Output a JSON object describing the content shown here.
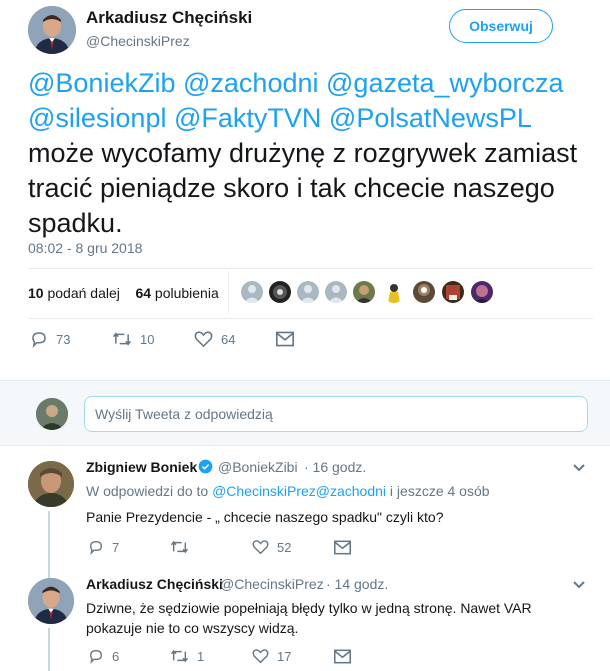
{
  "tweet": {
    "author_name": "Arkadiusz Chęciński",
    "author_handle": "@ChecinskiPrez",
    "follow_label": "Obserwuj",
    "text_mentions_line1": [
      "@BoniekZib",
      "@zachodni",
      "@gazeta_wyborcza"
    ],
    "text_mentions_line2": [
      "@silesionpl",
      "@FaktyTVN",
      "@PolsatNewsPL"
    ],
    "text_body": "może wycofamy drużynę z rozgrywek zamiast tracić pieniądze skoro i tak chcecie naszego spadku.",
    "timestamp": "08:02 - 8 gru 2018",
    "retweets_count": "10",
    "retweets_label": "podań dalej",
    "likes_count": "64",
    "likes_label": "polubienia",
    "actions": {
      "replies": "73",
      "retweets": "10",
      "likes": "64"
    }
  },
  "reply_box": {
    "placeholder": "Wyślij Tweeta z odpowiedzią"
  },
  "replies": [
    {
      "name": "Zbigniew Boniek",
      "handle": "@BoniekZibi",
      "time": "· 16 godz.",
      "context_prefix": "W odpowiedzi do to",
      "context_mentions": "@ChecinskiPrez@zachodni",
      "context_suffix": "i jeszcze 4 osób",
      "text": "Panie Prezydencie - „ chcecie naszego spadku\" czyli kto?",
      "actions": {
        "replies": "7",
        "retweets": "",
        "likes": "52"
      }
    },
    {
      "name": "Arkadiusz Chęciński",
      "handle": "@ChecinskiPrez",
      "time": "· 14 godz.",
      "text": "Dziwne, że sędziowie popełniają błędy tylko w jedną stronę.  Nawet VAR pokazuje nie to co wszyscy widzą.",
      "actions": {
        "replies": "6",
        "retweets": "1",
        "likes": "17"
      }
    }
  ],
  "colors": {
    "accent": "#1da1f2",
    "muted": "#657786",
    "verified": "#1da1f2"
  },
  "icons": [
    "reply-icon",
    "retweet-icon",
    "heart-icon",
    "direct-message-icon",
    "chevron-down-icon",
    "verified-badge-icon"
  ]
}
